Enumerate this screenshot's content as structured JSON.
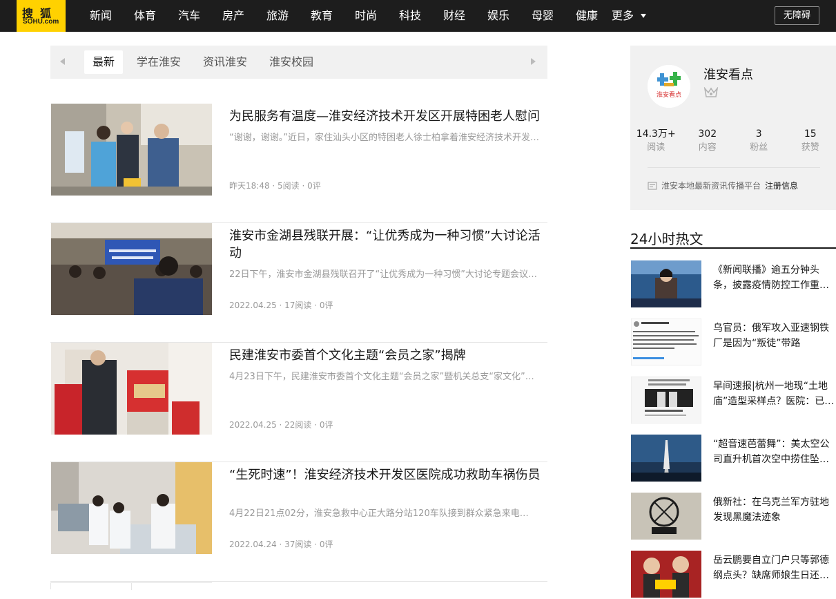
{
  "header": {
    "logo_cn": "搜狐",
    "logo_en": "SOHU.com",
    "nav": [
      "新闻",
      "体育",
      "汽车",
      "房产",
      "旅游",
      "教育",
      "时尚",
      "科技",
      "财经",
      "娱乐",
      "母婴",
      "健康"
    ],
    "more_label": "更多",
    "accessibility_label": "无障碍"
  },
  "tabs": [
    "最新",
    "学在淮安",
    "资讯淮安",
    "淮安校园"
  ],
  "feed": [
    {
      "title": "为民服务有温度—淮安经济技术开发区开展特困老人慰问",
      "summary": "“谢谢，谢谢。”近日，家住汕头小区的特困老人徐士柏拿着淮安经济技术开发区…",
      "meta": "昨天18:48 · 5阅读 · 0评"
    },
    {
      "title": "淮安市金湖县残联开展：“让优秀成为一种习惯”大讨论活动",
      "summary": "22日下午，淮安市金湖县残联召开了“让优秀成为一种习惯”大讨论专题会议…",
      "meta": "2022.04.25 · 17阅读 · 0评"
    },
    {
      "title": "民建淮安市委首个文化主题“会员之家”揭牌",
      "summary": "4月23日下午，民建淮安市委首个文化主题“会员之家”暨机关总支“家文化”…",
      "meta": "2022.04.25 · 22阅读 · 0评"
    },
    {
      "title": "“生死时速”！淮安经济技术开发区医院成功救助车祸伤员",
      "summary": "4月22日21点02分，淮安急救中心正大路分站120车队接到群众紧急来电…",
      "meta": "2022.04.24 · 37阅读 · 0评"
    }
  ],
  "profile": {
    "name": "淮安看点",
    "avatar_text": "淮安看点",
    "stats": [
      {
        "value": "14.3万+",
        "label": "阅读"
      },
      {
        "value": "302",
        "label": "内容"
      },
      {
        "value": "3",
        "label": "粉丝"
      },
      {
        "value": "15",
        "label": "获赞"
      }
    ],
    "description": "淮安本地最新资讯传播平台",
    "register_label": "注册信息"
  },
  "hot": {
    "title": "24小时热文",
    "items": [
      "《新闻联播》逾五分钟头条，披露疫情防控工作重磅…",
      "乌官员：俄军攻入亚速钢铁厂是因为“叛徒”带路",
      "早间速报|杭州一地现“土地庙”造型采样点？医院：已…",
      "“超音速芭蕾舞”：美太空公司直升机首次空中捞住坠…",
      "俄新社：在乌克兰军方驻地发现黑魔法迹象",
      "岳云鹏要自立门户只等郭德纲点头？缺席师娘生日还退…"
    ]
  }
}
